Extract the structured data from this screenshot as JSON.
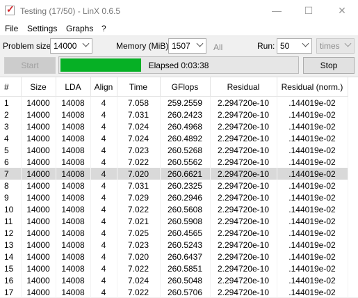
{
  "window": {
    "title": "Testing (17/50) - LinX 0.6.5",
    "minimize_glyph": "—",
    "maximize_glyph": "☐",
    "close_glyph": "✕"
  },
  "menu": [
    "File",
    "Settings",
    "Graphs",
    "?"
  ],
  "settings": {
    "problem_size_label": "Problem size:",
    "problem_size_value": "14000",
    "memory_label": "Memory (MiB):",
    "memory_value": "1507",
    "all_label": "All",
    "run_label": "Run:",
    "run_value": "50",
    "run_unit": "times"
  },
  "controls": {
    "start_label": "Start",
    "stop_label": "Stop",
    "elapsed_text": "Elapsed 0:03:38",
    "progress_fraction": 0.34,
    "progress_color": "#06b025"
  },
  "table": {
    "headers": [
      "#",
      "Size",
      "LDA",
      "Align",
      "Time",
      "GFlops",
      "Residual",
      "Residual (norm.)"
    ],
    "selected_row": 6,
    "rows": [
      [
        "1",
        "14000",
        "14008",
        "4",
        "7.058",
        "259.2559",
        "2.294720e-10",
        ".144019e-02"
      ],
      [
        "2",
        "14000",
        "14008",
        "4",
        "7.031",
        "260.2423",
        "2.294720e-10",
        ".144019e-02"
      ],
      [
        "3",
        "14000",
        "14008",
        "4",
        "7.024",
        "260.4968",
        "2.294720e-10",
        ".144019e-02"
      ],
      [
        "4",
        "14000",
        "14008",
        "4",
        "7.024",
        "260.4892",
        "2.294720e-10",
        ".144019e-02"
      ],
      [
        "5",
        "14000",
        "14008",
        "4",
        "7.023",
        "260.5268",
        "2.294720e-10",
        ".144019e-02"
      ],
      [
        "6",
        "14000",
        "14008",
        "4",
        "7.022",
        "260.5562",
        "2.294720e-10",
        ".144019e-02"
      ],
      [
        "7",
        "14000",
        "14008",
        "4",
        "7.020",
        "260.6621",
        "2.294720e-10",
        ".144019e-02"
      ],
      [
        "8",
        "14000",
        "14008",
        "4",
        "7.031",
        "260.2325",
        "2.294720e-10",
        ".144019e-02"
      ],
      [
        "9",
        "14000",
        "14008",
        "4",
        "7.029",
        "260.2946",
        "2.294720e-10",
        ".144019e-02"
      ],
      [
        "10",
        "14000",
        "14008",
        "4",
        "7.022",
        "260.5608",
        "2.294720e-10",
        ".144019e-02"
      ],
      [
        "11",
        "14000",
        "14008",
        "4",
        "7.021",
        "260.5908",
        "2.294720e-10",
        ".144019e-02"
      ],
      [
        "12",
        "14000",
        "14008",
        "4",
        "7.025",
        "260.4565",
        "2.294720e-10",
        ".144019e-02"
      ],
      [
        "13",
        "14000",
        "14008",
        "4",
        "7.023",
        "260.5243",
        "2.294720e-10",
        ".144019e-02"
      ],
      [
        "14",
        "14000",
        "14008",
        "4",
        "7.020",
        "260.6437",
        "2.294720e-10",
        ".144019e-02"
      ],
      [
        "15",
        "14000",
        "14008",
        "4",
        "7.022",
        "260.5851",
        "2.294720e-10",
        ".144019e-02"
      ],
      [
        "16",
        "14000",
        "14008",
        "4",
        "7.024",
        "260.5048",
        "2.294720e-10",
        ".144019e-02"
      ],
      [
        "17",
        "14000",
        "14008",
        "4",
        "7.022",
        "260.5706",
        "2.294720e-10",
        ".144019e-02"
      ]
    ]
  }
}
